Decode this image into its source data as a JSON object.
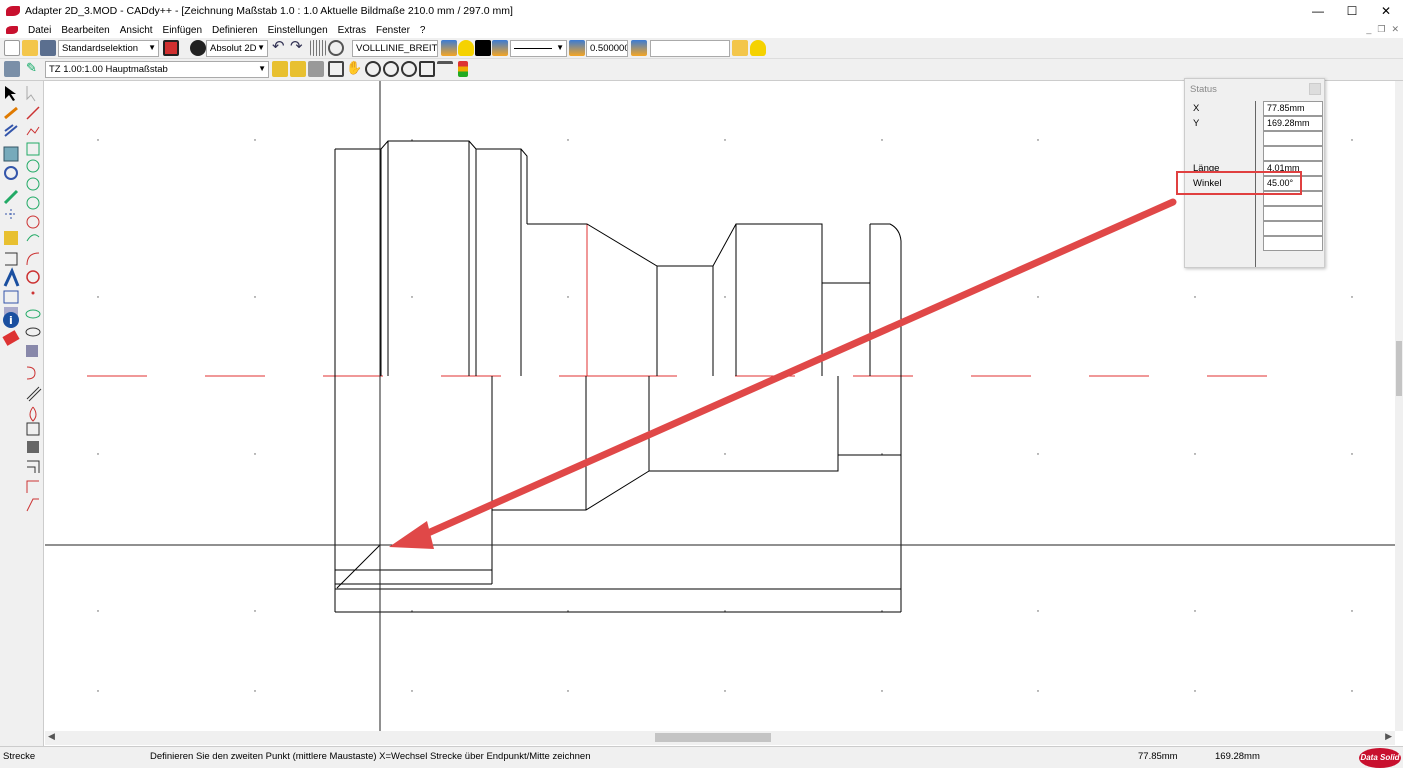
{
  "window": {
    "title": "Adapter 2D_3.MOD  -  CADdy++ - [Zeichnung   Maßstab 1.0 : 1.0   Aktuelle Bildmaße 210.0 mm / 297.0 mm]",
    "minimize": "—",
    "maximize": "☐",
    "close": "✕"
  },
  "menu": {
    "items": [
      "Datei",
      "Bearbeiten",
      "Ansicht",
      "Einfügen",
      "Definieren",
      "Einstellungen",
      "Extras",
      "Fenster",
      "?"
    ],
    "mdi_minimize": "_",
    "mdi_restore": "❐",
    "mdi_close": "✕"
  },
  "toolbar": {
    "selection_mode": "Standardselektion",
    "coord_mode": "Absolut 2D",
    "line_type": "VOLLLINIE_BREIT",
    "line_width": "0.500000",
    "empty_field": "",
    "scale_zone": "TZ 1.00:1.00 Hauptmaßstab"
  },
  "status_panel": {
    "title": "Status",
    "rows": [
      {
        "label": "X",
        "value": "77.85mm"
      },
      {
        "label": "Y",
        "value": "169.28mm"
      },
      {
        "label": "",
        "value": ""
      },
      {
        "label": "",
        "value": ""
      },
      {
        "label": "Länge",
        "value": "4.01mm"
      },
      {
        "label": "Winkel",
        "value": "45.00°"
      },
      {
        "label": "",
        "value": ""
      },
      {
        "label": "",
        "value": ""
      },
      {
        "label": "",
        "value": ""
      },
      {
        "label": "",
        "value": ""
      }
    ]
  },
  "statusbar": {
    "mode": "Strecke",
    "hint": "Definieren Sie den zweiten Punkt (mittlere Maustaste) X=Wechsel Strecke über Endpunkt/Mitte zeichnen",
    "x": "77.85mm",
    "y": "169.28mm",
    "logo": "Data Solid"
  },
  "colors": {
    "centerline": "#e03030",
    "annotation_arrow": "#e04848",
    "highlight_box": "#e04040",
    "geometry": "#000000"
  }
}
